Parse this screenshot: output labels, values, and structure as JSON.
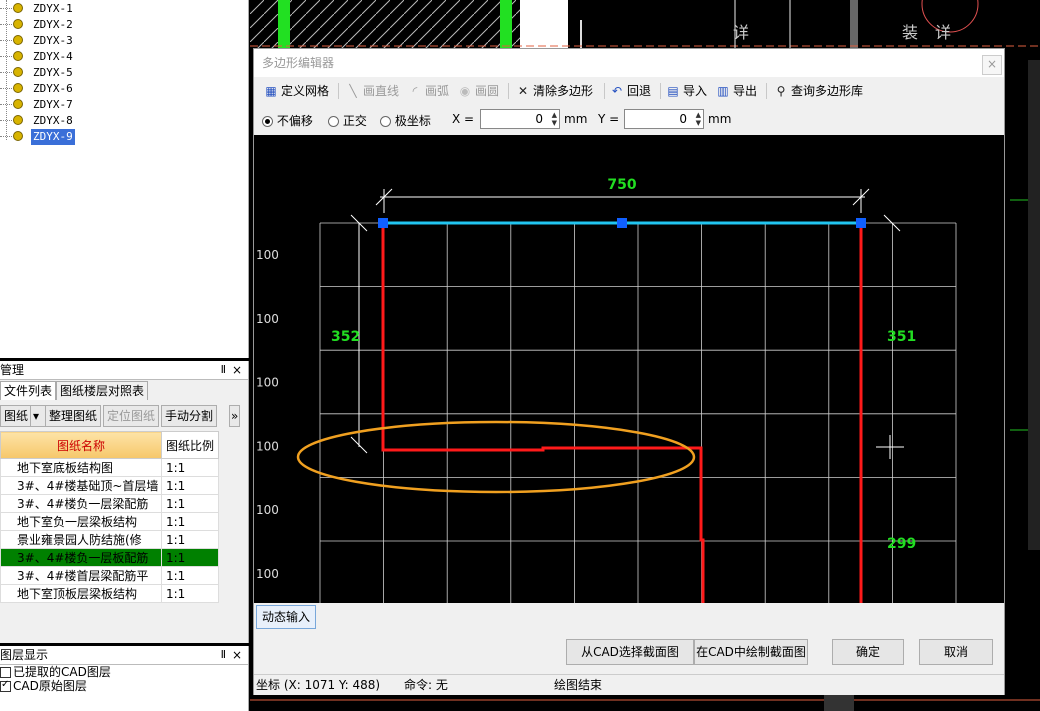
{
  "tree": {
    "items": [
      "ZDYX-1",
      "ZDYX-2",
      "ZDYX-3",
      "ZDYX-4",
      "ZDYX-5",
      "ZDYX-6",
      "ZDYX-7",
      "ZDYX-8",
      "ZDYX-9"
    ],
    "selected_index": 8
  },
  "manage_panel": {
    "title": "管理",
    "pin": "Ⅱ",
    "close": "×",
    "tabs": [
      "文件列表",
      "图纸楼层对照表"
    ],
    "toolbar": {
      "drawing_btn": "图纸",
      "dropdown": "▾",
      "organize": "整理图纸",
      "locate": "定位图纸",
      "manual_split": "手动分割",
      "more": "»"
    },
    "columns": {
      "name": "图纸名称",
      "ratio": "图纸比例"
    },
    "rows": [
      {
        "name": "地下室底板结构图",
        "ratio": "1:1"
      },
      {
        "name": "3#、4#楼基础顶~首层墙",
        "ratio": "1:1"
      },
      {
        "name": "3#、4#楼负一层梁配筋",
        "ratio": "1:1"
      },
      {
        "name": "地下室负一层梁板结构",
        "ratio": "1:1"
      },
      {
        "name": "景业雍景园人防结施(修",
        "ratio": "1:1"
      },
      {
        "name": "3#、4#楼负一层板配筋",
        "ratio": "1:1"
      },
      {
        "name": "3#、4#楼首层梁配筋平",
        "ratio": "1:1"
      },
      {
        "name": "地下室顶板层梁板结构",
        "ratio": "1:1"
      }
    ],
    "selected_row": 5
  },
  "layer_panel": {
    "title": "图层显示",
    "pin": "Ⅱ",
    "close": "×",
    "items": [
      {
        "label": "已提取的CAD图层",
        "checked": false
      },
      {
        "label": "CAD原始图层",
        "checked": true
      }
    ]
  },
  "dialog": {
    "title": "多边形编辑器",
    "close": "×",
    "toolbar": [
      {
        "label": "定义网格",
        "icon": "grid-icon",
        "enabled": true
      },
      {
        "label": "画直线",
        "icon": "line-icon",
        "enabled": false
      },
      {
        "label": "画弧",
        "icon": "arc-icon",
        "enabled": false
      },
      {
        "label": "画圆",
        "icon": "circle-icon",
        "enabled": false
      },
      {
        "label": "清除多边形",
        "icon": "clear-icon",
        "enabled": true
      },
      {
        "label": "回退",
        "icon": "undo-icon",
        "enabled": true
      },
      {
        "label": "导入",
        "icon": "import-icon",
        "enabled": true
      },
      {
        "label": "导出",
        "icon": "export-icon",
        "enabled": true
      },
      {
        "label": "查询多边形库",
        "icon": "search-icon",
        "enabled": true
      }
    ],
    "options": {
      "modes": [
        {
          "label": "不偏移",
          "selected": true
        },
        {
          "label": "正交",
          "selected": false
        },
        {
          "label": "极坐标",
          "selected": false
        }
      ],
      "x_label": "X =",
      "x_value": "0",
      "y_label": "Y =",
      "y_value": "0",
      "unit": "mm"
    },
    "canvas": {
      "dim_top": "750",
      "dim_left": "352",
      "dim_right": "351",
      "dim_right_lower": "299",
      "grid_labels": [
        "100",
        "100",
        "100",
        "100",
        "100",
        "100"
      ],
      "colors": {
        "polygon": "#ff1a1a",
        "selected_edge": "#21c5f0",
        "vertex": "#1060ff",
        "dimension": "#22dd22",
        "highlight": "#f0a020",
        "grid": "#d0d0d0"
      }
    },
    "dynamic_input": "动态输入",
    "buttons": {
      "select_from_cad": "从CAD选择截面图",
      "draw_in_cad": "在CAD中绘制截面图",
      "ok": "确定",
      "cancel": "取消"
    },
    "status": {
      "coords": "坐标 (X: 1071 Y: 488)",
      "command": "命令: 无",
      "message": "绘图结束"
    }
  },
  "cad_bg": {
    "labels": [
      "详",
      "装",
      "详"
    ]
  }
}
